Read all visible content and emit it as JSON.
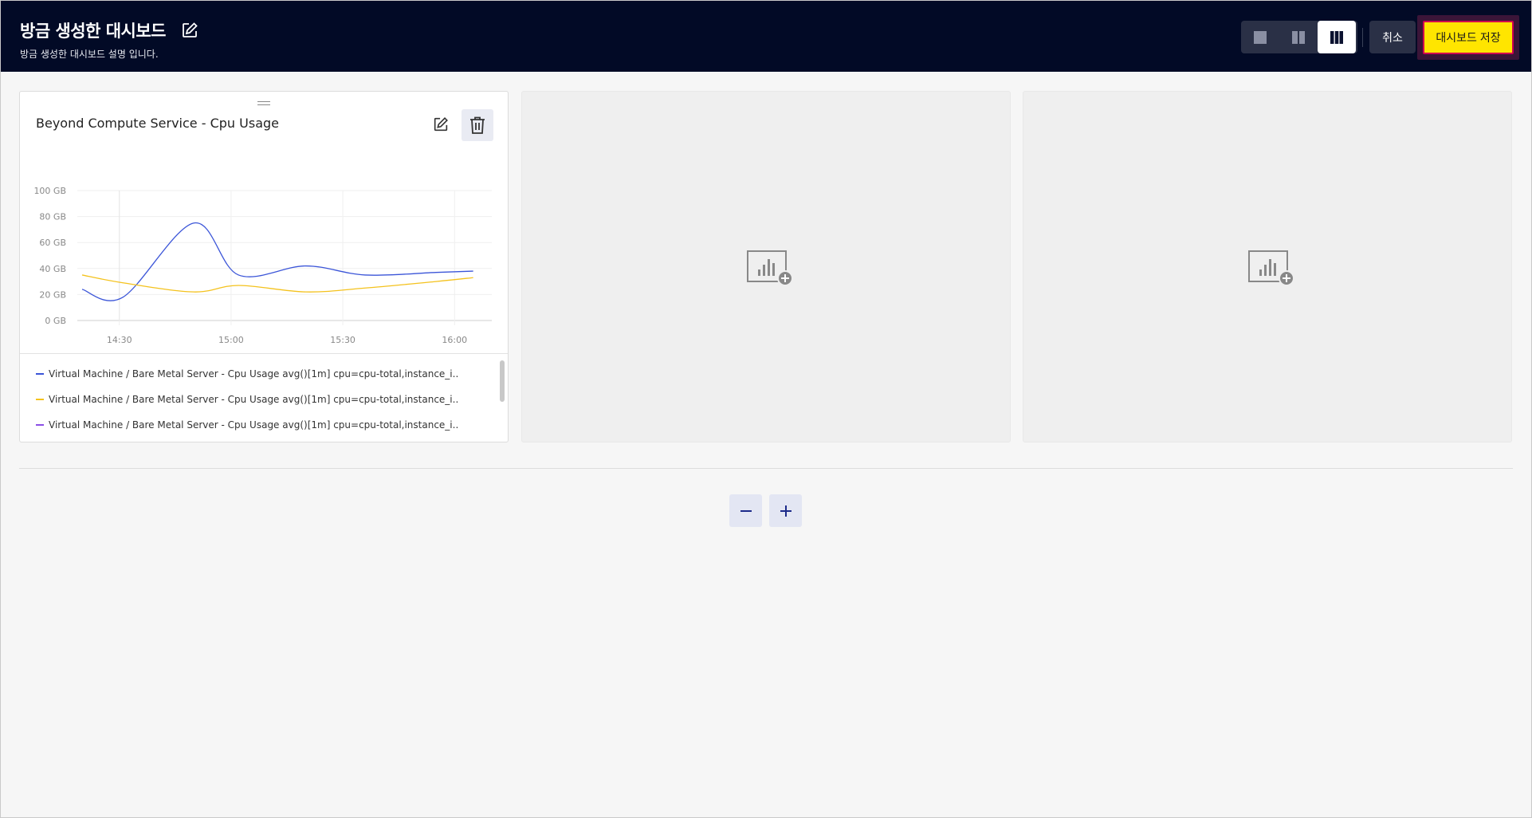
{
  "header": {
    "title": "방금 생성한 대시보드",
    "description": "방금 생성한 대시보드 설명 입니다.",
    "cancel_label": "취소",
    "save_label": "대시보드 저장",
    "layout_options": [
      "single-column",
      "two-column",
      "three-column"
    ],
    "selected_layout": "three-column"
  },
  "widget": {
    "title": "Beyond Compute Service - Cpu Usage",
    "legend": [
      {
        "label": "Virtual Machine / Bare Metal Server - Cpu Usage avg()[1m] cpu=cpu-total,instance_i..",
        "color": "#3b55d8"
      },
      {
        "label": "Virtual Machine / Bare Metal Server - Cpu Usage avg()[1m] cpu=cpu-total,instance_i..",
        "color": "#f4c21d"
      },
      {
        "label": "Virtual Machine / Bare Metal Server - Cpu Usage avg()[1m] cpu=cpu-total,instance_i..",
        "color": "#8b4fe6"
      }
    ]
  },
  "chart_data": {
    "type": "line",
    "x_ticks": [
      "14:30",
      "15:00",
      "15:30",
      "16:00"
    ],
    "y_ticks": [
      "0 GB",
      "20 GB",
      "40 GB",
      "60 GB",
      "80 GB",
      "100 GB"
    ],
    "ylim": [
      0,
      100
    ],
    "x_minutes": [
      25,
      36,
      55,
      67,
      85,
      101,
      120,
      130
    ],
    "series": [
      {
        "color": "#3b55d8",
        "values": [
          24,
          18,
          75,
          35,
          42,
          35,
          37,
          38
        ]
      },
      {
        "color": "#f4c21d",
        "values": [
          35,
          29,
          22,
          27,
          22,
          25,
          30,
          33
        ]
      }
    ],
    "grid": true
  },
  "empty_slots": 2,
  "controls": {
    "minus": "−",
    "plus": "+"
  }
}
